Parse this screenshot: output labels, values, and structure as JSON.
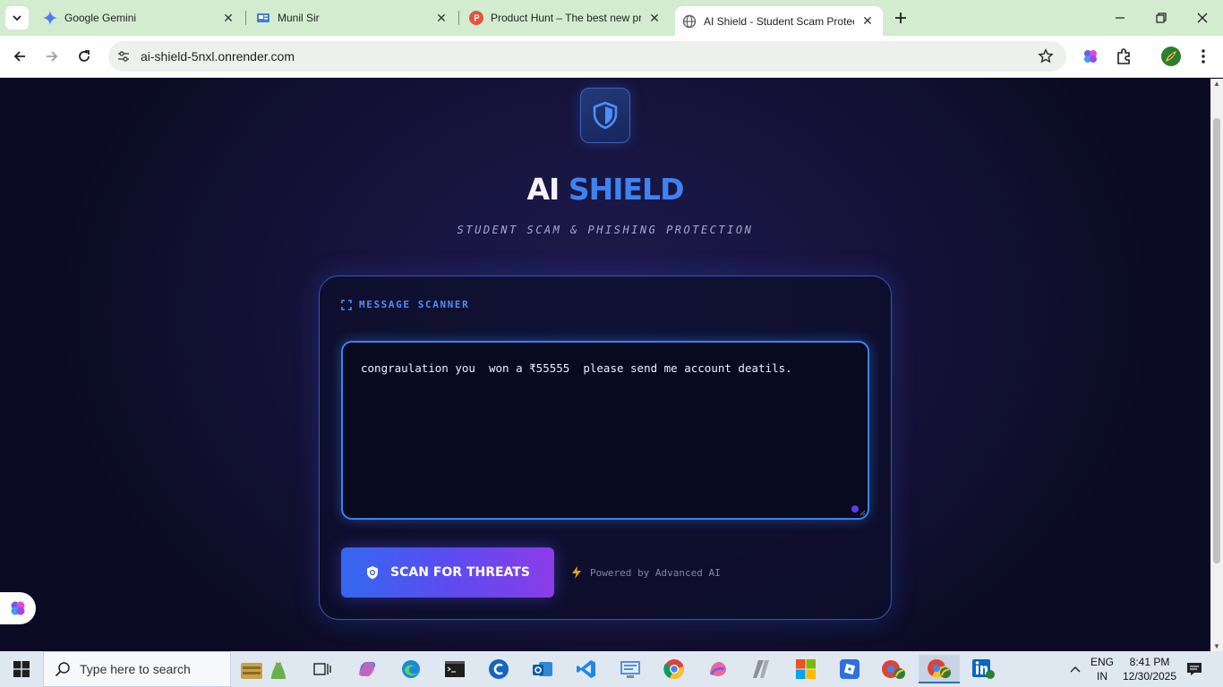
{
  "browser": {
    "tabs": [
      {
        "title": "Google Gemini",
        "icon": "gemini-icon"
      },
      {
        "title": "Munil Sir",
        "icon": "document-icon"
      },
      {
        "title": "Product Hunt – The best new pr",
        "icon": "product-hunt-icon"
      },
      {
        "title": "AI Shield - Student Scam Protec",
        "icon": "globe-icon",
        "active": true
      }
    ],
    "url": "ai-shield-5nxl.onrender.com"
  },
  "app": {
    "brand_part1": "AI",
    "brand_part2": "SHIELD",
    "tagline": "STUDENT SCAM & PHISHING PROTECTION",
    "scanner_label": "MESSAGE SCANNER",
    "message_value": "congraulation you  won a ₹55555  please send me account deatils.",
    "scan_button_label": "SCAN FOR THREATS",
    "powered_by": "Powered by Advanced AI",
    "colors": {
      "accent": "#3f83f0",
      "button_start": "#3468ef",
      "button_end": "#8a3ce8",
      "background": "#15133a"
    }
  },
  "taskbar": {
    "search_placeholder": "Type here to search",
    "language_line1": "ENG",
    "language_line2": "IN",
    "time": "8:41 PM",
    "date": "12/30/2025"
  }
}
